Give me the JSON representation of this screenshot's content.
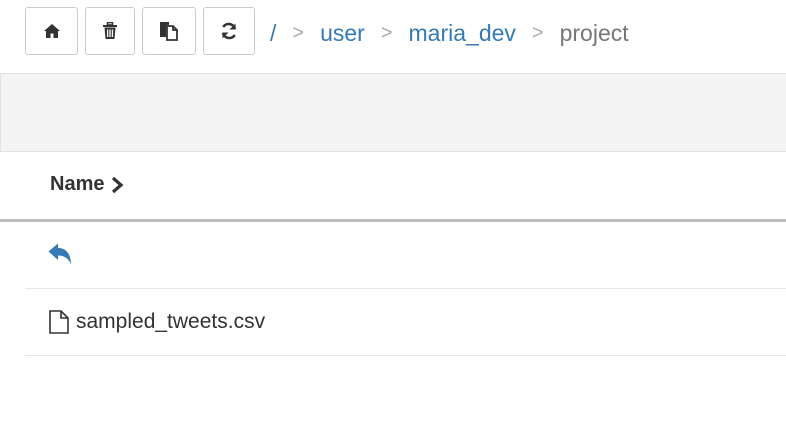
{
  "toolbar": {
    "buttons": [
      {
        "name": "home",
        "icon": "home-icon"
      },
      {
        "name": "delete",
        "icon": "trash-icon"
      },
      {
        "name": "paste",
        "icon": "paste-icon"
      },
      {
        "name": "refresh",
        "icon": "refresh-icon"
      }
    ]
  },
  "breadcrumb": {
    "root": "/",
    "separator": ">",
    "items": [
      {
        "label": "user",
        "link": true
      },
      {
        "label": "maria_dev",
        "link": true
      },
      {
        "label": "project",
        "link": false
      }
    ]
  },
  "table": {
    "columns": [
      {
        "label": "Name",
        "sort_icon": "chevron-right-icon"
      }
    ],
    "rows": [
      {
        "type": "parent-directory",
        "icon": "reply-arrow-icon"
      },
      {
        "type": "file",
        "icon": "file-icon",
        "name": "sampled_tweets.csv"
      }
    ]
  },
  "colors": {
    "link": "#337ab7",
    "text": "#333333",
    "muted": "#777777",
    "band": "#f4f4f4"
  }
}
